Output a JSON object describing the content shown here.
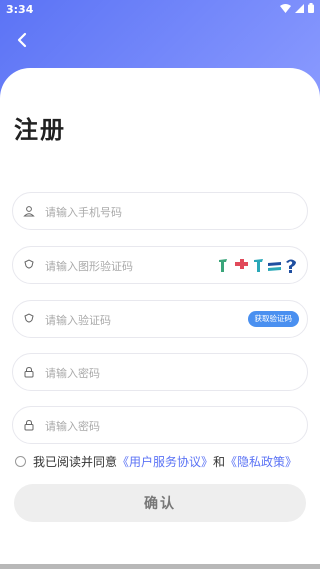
{
  "status_bar": {
    "time": "3:34"
  },
  "page": {
    "title": "注册"
  },
  "fields": {
    "phone": {
      "placeholder": "请输入手机号码"
    },
    "image_code": {
      "placeholder": "请输入图形验证码"
    },
    "sms_code": {
      "placeholder": "请输入验证码",
      "button_label": "获取验证码"
    },
    "password": {
      "placeholder": "请输入密码"
    },
    "password_confirm": {
      "placeholder": "请输入密码"
    }
  },
  "agreement": {
    "prefix": "我已阅读并同意",
    "terms_link": "《用户服务协议》",
    "conjunction": "和",
    "privacy_link": "《隐私政策》"
  },
  "confirm_label": "确认",
  "colors": {
    "header_start": "#5b73f5",
    "header_end": "#8c9cff",
    "accent": "#5b73f5",
    "button_blue": "#4a90f0"
  }
}
